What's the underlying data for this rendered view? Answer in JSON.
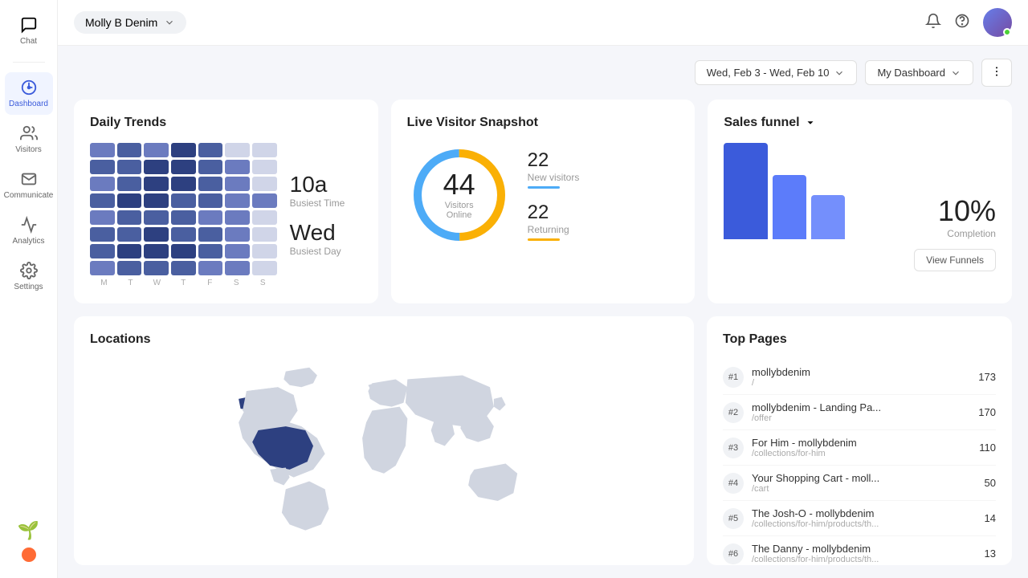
{
  "header": {
    "store_name": "Molly B Denim",
    "date_range": "Wed, Feb 3 - Wed, Feb 10",
    "dashboard_label": "My Dashboard"
  },
  "sidebar": {
    "items": [
      {
        "label": "Chat",
        "icon": "chat"
      },
      {
        "label": "Dashboard",
        "icon": "dashboard",
        "active": true
      },
      {
        "label": "Visitors",
        "icon": "visitors"
      },
      {
        "label": "Communicate",
        "icon": "communicate"
      },
      {
        "label": "Analytics",
        "icon": "analytics"
      },
      {
        "label": "Settings",
        "icon": "settings"
      }
    ]
  },
  "daily_trends": {
    "title": "Daily Trends",
    "busiest_time_value": "10a",
    "busiest_time_label": "Busiest Time",
    "busiest_day_value": "Wed",
    "busiest_day_label": "Busiest Day",
    "days": [
      "M",
      "T",
      "W",
      "T",
      "F",
      "S",
      "S"
    ]
  },
  "live_visitor": {
    "title": "Live Visitor Snapshot",
    "visitors_count": "44",
    "visitors_label": "Visitors Online",
    "new_visitors_count": "22",
    "new_visitors_label": "New visitors",
    "returning_count": "22",
    "returning_label": "Returning"
  },
  "sales_funnel": {
    "title": "Sales funnel",
    "completion_pct": "10%",
    "completion_label": "Completion",
    "view_funnels_label": "View Funnels"
  },
  "locations": {
    "title": "Locations"
  },
  "top_pages": {
    "title": "Top Pages",
    "pages": [
      {
        "rank": "#1",
        "name": "mollybdenim",
        "url": "/",
        "count": 173
      },
      {
        "rank": "#2",
        "name": "mollybdenim - Landing Pa...",
        "url": "/offer",
        "count": 170
      },
      {
        "rank": "#3",
        "name": "For Him - mollybdenim",
        "url": "/collections/for-him",
        "count": 110
      },
      {
        "rank": "#4",
        "name": "Your Shopping Cart - moll...",
        "url": "/cart",
        "count": 50
      },
      {
        "rank": "#5",
        "name": "The Josh-O - mollybdenim",
        "url": "/collections/for-him/products/th...",
        "count": 14
      },
      {
        "rank": "#6",
        "name": "The Danny - mollybdenim",
        "url": "/collections/for-him/products/th...",
        "count": 13
      }
    ]
  }
}
